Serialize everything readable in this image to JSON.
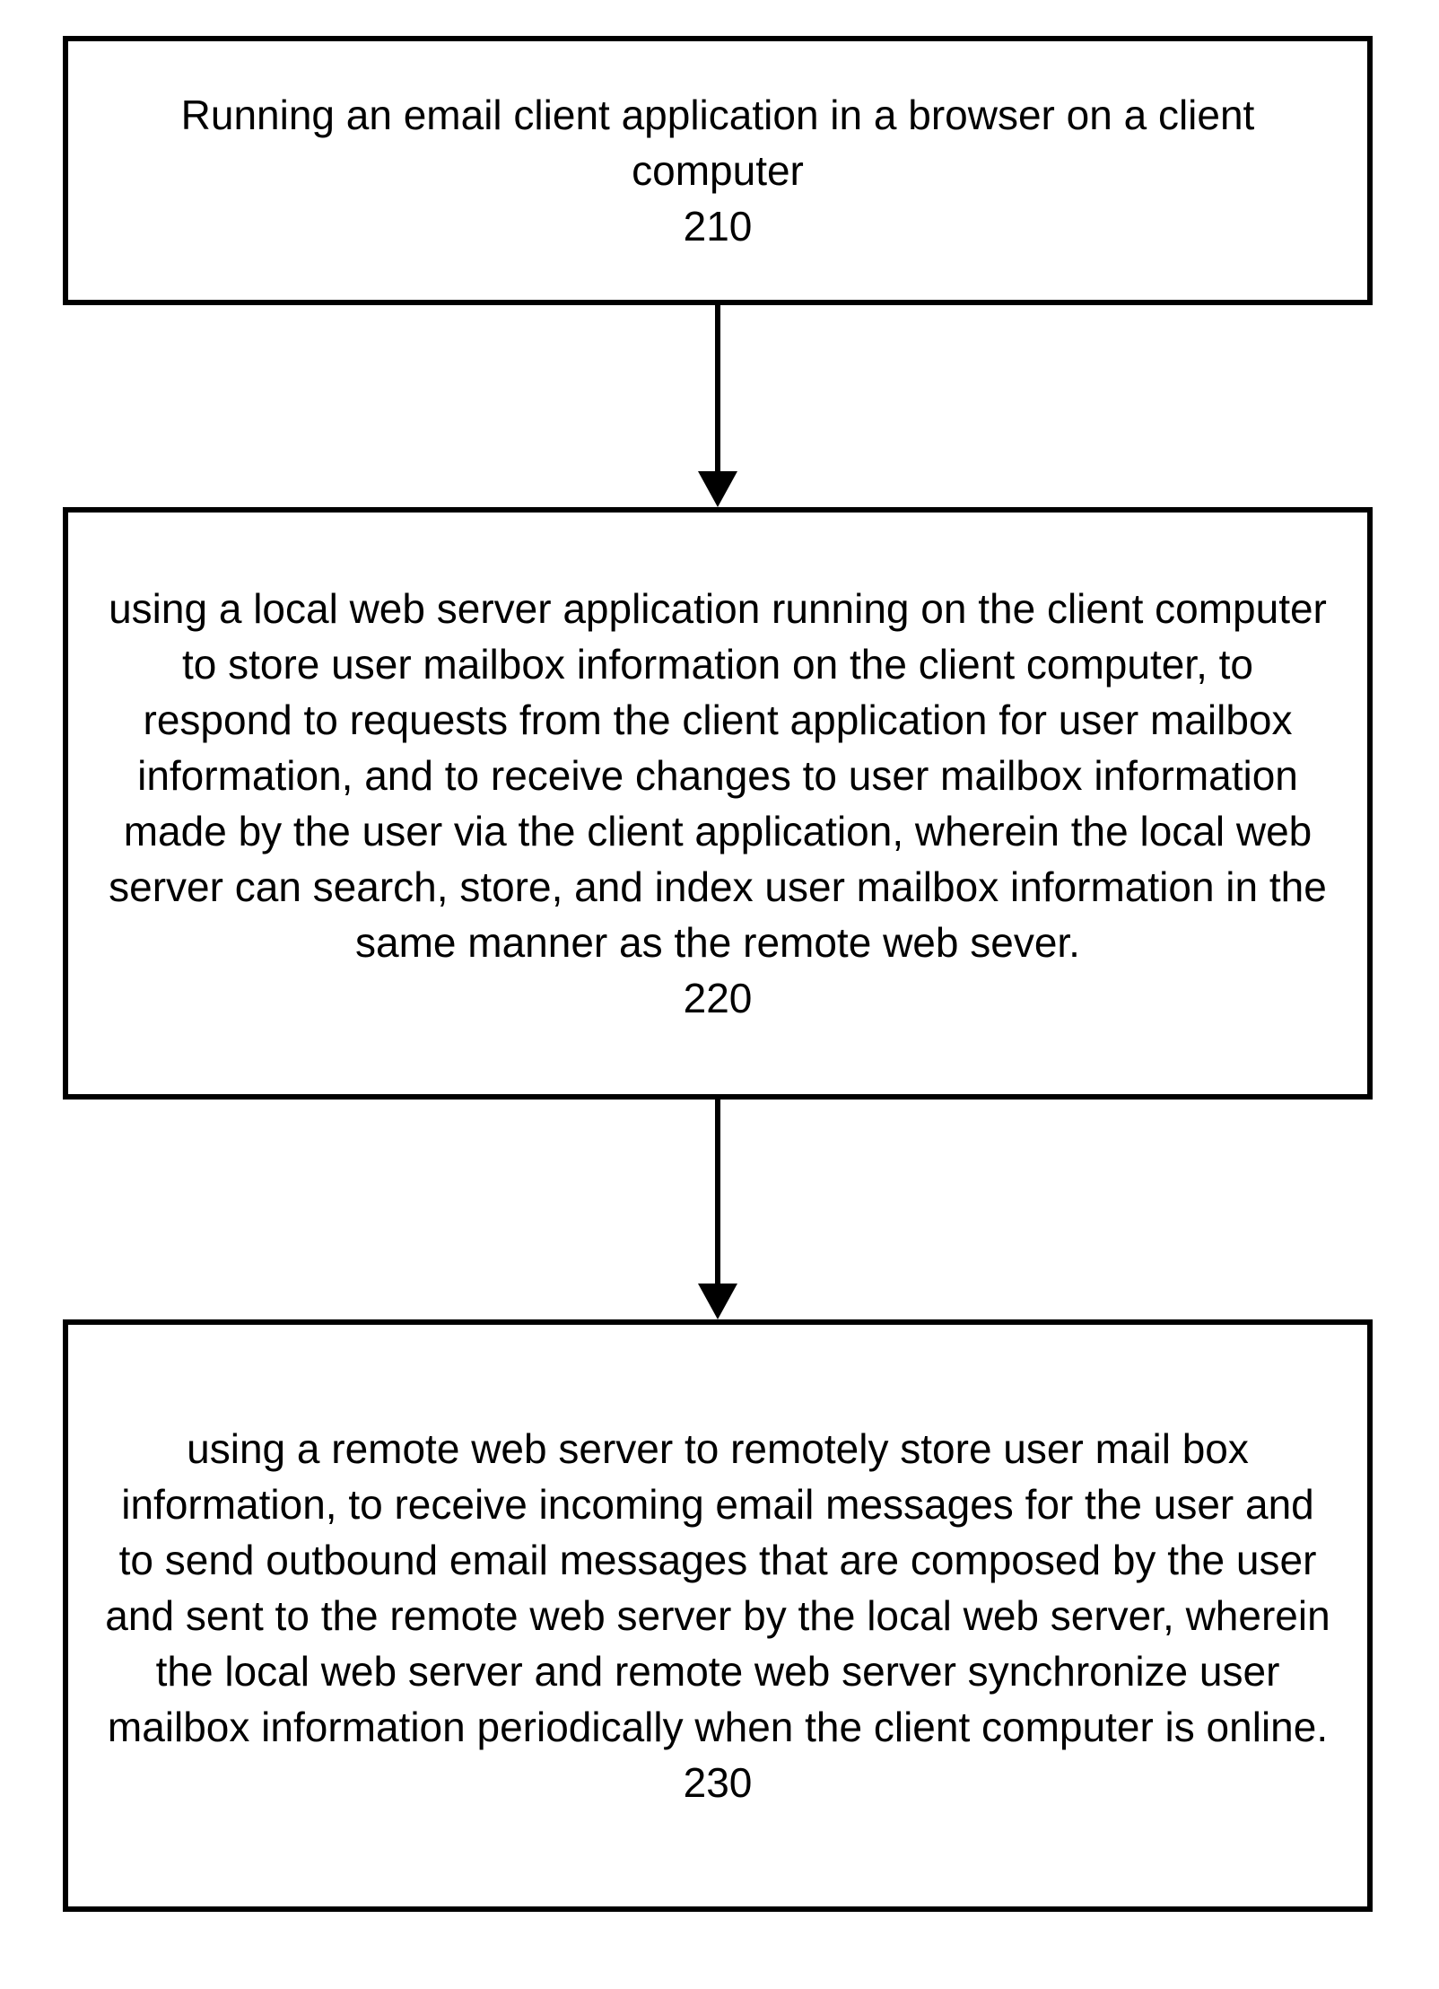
{
  "chart_data": {
    "type": "flowchart",
    "direction": "top-to-bottom",
    "nodes": [
      {
        "id": "210",
        "ref": "210",
        "text": "Running an email client application in a browser on a client computer"
      },
      {
        "id": "220",
        "ref": "220",
        "text": "using a local web server application running on the client computer to store user mailbox information on the client computer, to respond to requests from the client application for user mailbox information, and to receive changes to user mailbox information made by the user via the client application, wherein the local web server can search, store, and index user mailbox information in the same manner as the remote web sever."
      },
      {
        "id": "230",
        "ref": "230",
        "text": "using a remote web server to remotely store user mail box information, to receive incoming email messages for the user and to send outbound email messages that are composed by the user and sent to the remote web server by the local web server, wherein the local web server and remote web server synchronize user mailbox information periodically when the client computer is online."
      }
    ],
    "edges": [
      {
        "from": "210",
        "to": "220"
      },
      {
        "from": "220",
        "to": "230"
      }
    ]
  }
}
